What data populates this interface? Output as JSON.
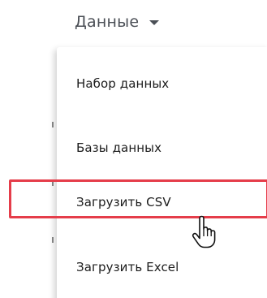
{
  "nav": {
    "label": "Данные",
    "caret_icon": "caret-down-icon"
  },
  "menu": {
    "items": [
      {
        "label": "Набор данных"
      },
      {
        "label": "Базы данных"
      },
      {
        "label": "Загрузить CSV"
      },
      {
        "label": "Загрузить Excel"
      }
    ]
  },
  "highlight_color": "#e53d4a",
  "cursor_icon": "hand-pointer-icon"
}
